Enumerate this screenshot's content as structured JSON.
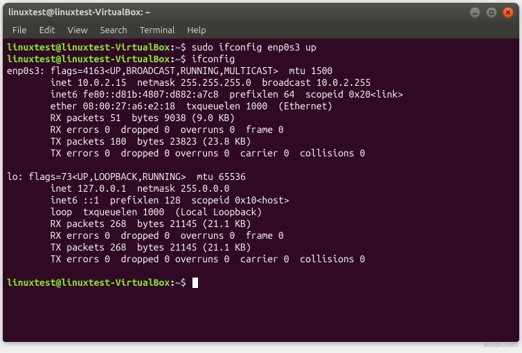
{
  "window": {
    "title": "linuxtest@linuxtest-VirtualBox: ~"
  },
  "menubar": {
    "items": [
      "File",
      "Edit",
      "View",
      "Search",
      "Terminal",
      "Help"
    ]
  },
  "prompt": {
    "user_host": "linuxtest@linuxtest-VirtualBox",
    "colon": ":",
    "path": "~",
    "dollar": "$"
  },
  "commands": {
    "cmd1": "sudo ifconfig enp0s3 up",
    "cmd2": "ifconfig"
  },
  "output_lines": [
    "enp0s3: flags=4163<UP,BROADCAST,RUNNING,MULTICAST>  mtu 1500",
    "        inet 10.0.2.15  netmask 255.255.255.0  broadcast 10.0.2.255",
    "        inet6 fe80::d81b:4807:d882:a7c8  prefixlen 64  scopeid 0x20<link>",
    "        ether 08:00:27:a6:e2:18  txqueuelen 1000  (Ethernet)",
    "        RX packets 51  bytes 9038 (9.0 KB)",
    "        RX errors 0  dropped 0  overruns 0  frame 0",
    "        TX packets 180  bytes 23823 (23.8 KB)",
    "        TX errors 0  dropped 0 overruns 0  carrier 0  collisions 0",
    "",
    "lo: flags=73<UP,LOOPBACK,RUNNING>  mtu 65536",
    "        inet 127.0.0.1  netmask 255.0.0.0",
    "        inet6 ::1  prefixlen 128  scopeid 0x10<host>",
    "        loop  txqueuelen 1000  (Local Loopback)",
    "        RX packets 268  bytes 21145 (21.1 KB)",
    "        RX errors 0  dropped 0  overruns 0  frame 0",
    "        TX packets 268  bytes 21145 (21.1 KB)",
    "        TX errors 0  dropped 0 overruns 0  carrier 0  collisions 0",
    ""
  ],
  "watermark": "wsxdn.com"
}
